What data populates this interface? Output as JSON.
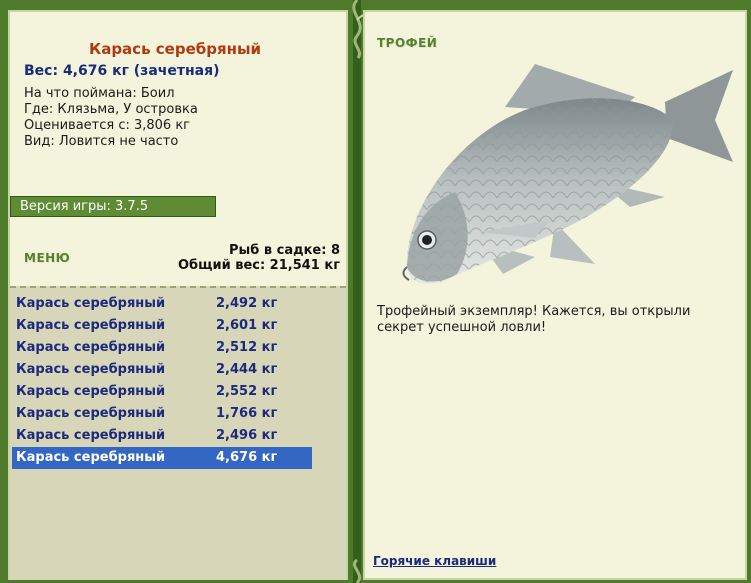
{
  "fish": {
    "title": "Карась серебряный",
    "weight_line": "Вес: 4,676 кг (зачетная)",
    "bait": "На что поймана: Боил",
    "where": "Где: Клязьма, У островка",
    "valued": "Оценивается с: 3,806 кг",
    "kind": "Вид: Ловится не часто"
  },
  "version": "Версия игры: 3.7.5",
  "menu_label": "МЕНЮ",
  "stats": {
    "count": "Рыб в садке: 8",
    "total": "Общий вес: 21,541 кг"
  },
  "catches": [
    {
      "name": "Карась серебряный",
      "weight": "2,492 кг"
    },
    {
      "name": "Карась серебряный",
      "weight": "2,601 кг"
    },
    {
      "name": "Карась серебряный",
      "weight": "2,512 кг"
    },
    {
      "name": "Карась серебряный",
      "weight": "2,444 кг"
    },
    {
      "name": "Карась серебряный",
      "weight": "2,552 кг"
    },
    {
      "name": "Карась серебряный",
      "weight": "1,766 кг"
    },
    {
      "name": "Карась серебряный",
      "weight": "2,496 кг"
    },
    {
      "name": "Карась серебряный",
      "weight": "4,676 кг"
    }
  ],
  "trophy": {
    "label": "ТРОФЕЙ",
    "text": "Трофейный экземпляр! Кажется, вы открыли секрет успешной ловли!",
    "hotkeys": "Горячие клавиши"
  },
  "colors": {
    "background": "#4e7a2c",
    "panel": "#f4f4dc",
    "selected_row": "#3467c4",
    "title": "#b03a10",
    "link": "#1b2a7c"
  }
}
